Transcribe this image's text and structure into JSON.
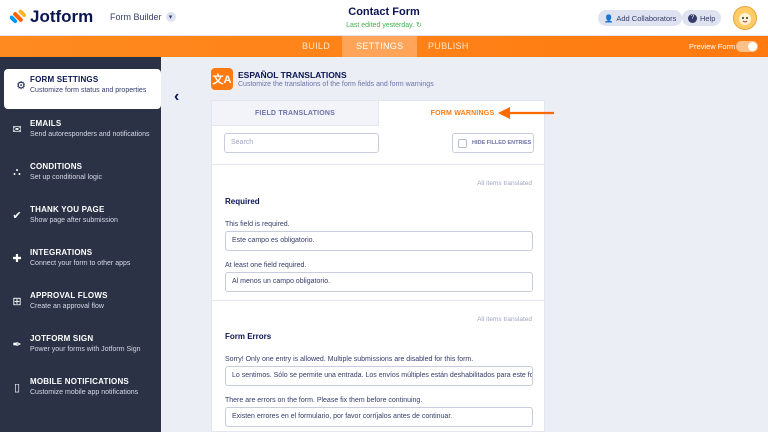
{
  "header": {
    "logo_text": "Jotform",
    "builder_label": "Form Builder",
    "form_title": "Contact Form",
    "last_edited": "Last edited yesterday.",
    "collaborators_label": "Add Collaborators",
    "help_label": "Help"
  },
  "nav": {
    "tabs": [
      "BUILD",
      "SETTINGS",
      "PUBLISH"
    ],
    "active_tab": "SETTINGS",
    "preview_label": "Preview Form"
  },
  "sidebar": {
    "items": [
      {
        "title": "FORM SETTINGS",
        "desc": "Customize form status and properties",
        "icon": "gear-icon"
      },
      {
        "title": "EMAILS",
        "desc": "Send autoresponders and notifications",
        "icon": "envelope-icon"
      },
      {
        "title": "CONDITIONS",
        "desc": "Set up conditional logic",
        "icon": "conditions-icon"
      },
      {
        "title": "THANK YOU PAGE",
        "desc": "Show page after submission",
        "icon": "check-circle-icon"
      },
      {
        "title": "INTEGRATIONS",
        "desc": "Connect your form to other apps",
        "icon": "puzzle-icon"
      },
      {
        "title": "APPROVAL FLOWS",
        "desc": "Create an approval flow",
        "icon": "approval-icon"
      },
      {
        "title": "JOTFORM SIGN",
        "desc": "Power your forms with Jotform Sign",
        "icon": "pen-icon"
      },
      {
        "title": "MOBILE NOTIFICATIONS",
        "desc": "Customize mobile app notifications",
        "icon": "mobile-icon"
      }
    ]
  },
  "main": {
    "title": "ESPAÑOL TRANSLATIONS",
    "subtitle": "Customize the translations of the form fields and form warnings",
    "tabs": [
      "FIELD TRANSLATIONS",
      "FORM WARNINGS"
    ],
    "active_tab": "FORM WARNINGS",
    "search_placeholder": "Search",
    "hide_filled_label": "HIDE FILLED ENTRIES",
    "sections": [
      {
        "status": "All items translated",
        "heading": "Required",
        "fields": [
          {
            "label": "This field is required.",
            "value": "Este campo es obligatorio."
          },
          {
            "label": "At least one field required.",
            "value": "Al menos un campo obligatorio."
          }
        ]
      },
      {
        "status": "All items translated",
        "heading": "Form Errors",
        "fields": [
          {
            "label": "Sorry! Only one entry is allowed. Multiple submissions are disabled for this form.",
            "value": "Lo sentimos. Sólo se permite una entrada. Los envíos múltiples están deshabilitados para este formulario."
          },
          {
            "label": "There are errors on the form. Please fix them before continuing.",
            "value": "Existen errores en el formulario, por favor corríjalos antes de continuar."
          }
        ]
      }
    ]
  },
  "colors": {
    "accent": "#ff7a10",
    "sidebar_bg": "#2b3245",
    "navy": "#0a1551"
  }
}
